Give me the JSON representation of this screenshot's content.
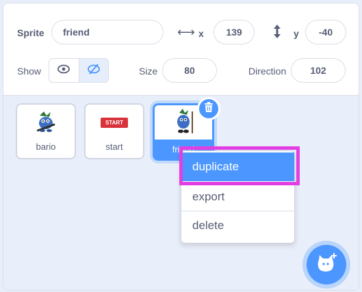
{
  "info": {
    "sprite_label": "Sprite",
    "sprite_name": "friend",
    "x_label": "x",
    "x_value": "139",
    "y_label": "y",
    "y_value": "-40",
    "show_label": "Show",
    "size_label": "Size",
    "size_value": "80",
    "direction_label": "Direction",
    "direction_value": "102"
  },
  "sprites": [
    {
      "name": "bario"
    },
    {
      "name": "start",
      "thumb_text": "START"
    },
    {
      "name": "friend"
    }
  ],
  "context_menu": [
    {
      "label": "duplicate"
    },
    {
      "label": "export"
    },
    {
      "label": "delete"
    }
  ],
  "colors": {
    "accent": "#4c97ff",
    "highlight": "#e13fe3",
    "text": "#575e75"
  }
}
